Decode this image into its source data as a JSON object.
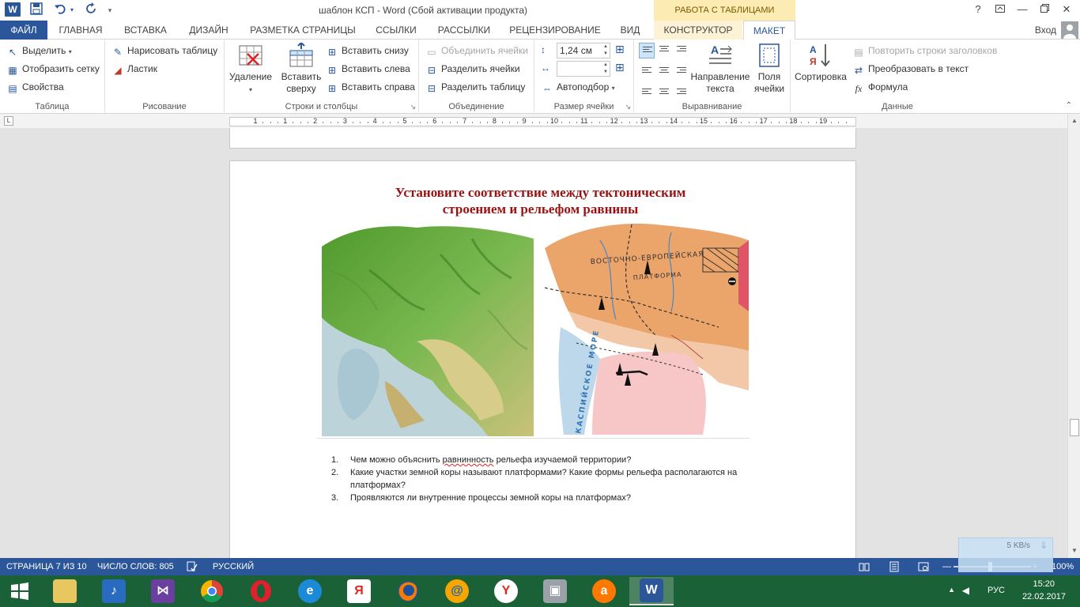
{
  "window": {
    "title": "шаблон КСП - Word (Сбой активации продукта)",
    "table_tools": "РАБОТА С ТАБЛИЦАМИ",
    "login": "Вход",
    "app_badge": "W"
  },
  "tabs": [
    {
      "label": "ФАЙЛ"
    },
    {
      "label": "ГЛАВНАЯ"
    },
    {
      "label": "ВСТАВКА"
    },
    {
      "label": "ДИЗАЙН"
    },
    {
      "label": "РАЗМЕТКА СТРАНИЦЫ"
    },
    {
      "label": "ССЫЛКИ"
    },
    {
      "label": "РАССЫЛКИ"
    },
    {
      "label": "РЕЦЕНЗИРОВАНИЕ"
    },
    {
      "label": "ВИД"
    },
    {
      "label": "КОНСТРУКТОР"
    },
    {
      "label": "МАКЕТ"
    }
  ],
  "ribbon": {
    "table": {
      "label": "Таблица",
      "select": "Выделить",
      "show_grid": "Отобразить сетку",
      "properties": "Свойства"
    },
    "draw": {
      "label": "Рисование",
      "draw_table": "Нарисовать таблицу",
      "eraser": "Ластик"
    },
    "rows_cols": {
      "label": "Строки и столбцы",
      "delete": "Удаление",
      "insert_above_1": "Вставить",
      "insert_above_2": "сверху",
      "insert_below": "Вставить снизу",
      "insert_left": "Вставить слева",
      "insert_right": "Вставить справа"
    },
    "merge": {
      "label": "Объединение",
      "merge_cells": "Объединить ячейки",
      "split_cells": "Разделить ячейки",
      "split_table": "Разделить таблицу"
    },
    "cell_size": {
      "label": "Размер ячейки",
      "height_value": "1,24 см",
      "width_value": "",
      "autofit": "Автоподбор"
    },
    "alignment": {
      "label": "Выравнивание",
      "text_direction_1": "Направление",
      "text_direction_2": "текста",
      "cell_margins_1": "Поля",
      "cell_margins_2": "ячейки"
    },
    "data": {
      "label": "Данные",
      "sort": "Сортировка",
      "repeat_header": "Повторить строки заголовков",
      "convert_text": "Преобразовать в текст",
      "formula": "Формула"
    }
  },
  "ruler": {
    "numbers": [
      "1",
      "1",
      "2",
      "3",
      "4",
      "5",
      "6",
      "7",
      "8",
      "9",
      "10",
      "11",
      "12",
      "13",
      "14",
      "15",
      "16",
      "17",
      "18",
      "19"
    ]
  },
  "document": {
    "slide_title_1": "Установите соответствие между тектоническим",
    "slide_title_2": "строением и рельефом равнины",
    "map_labels": {
      "platform_1": "ВОСТОЧНО-ЕВРОПЕЙСКАЯ",
      "platform_2": "ПЛАТФОРМА",
      "sea": "КАСПИЙСКОЕ МОРЕ"
    },
    "questions": [
      {
        "num": "1.",
        "pre": "Чем можно объяснить ",
        "spell": "равнинность",
        "post": " рельефа изучаемой территории?"
      },
      {
        "num": "2.",
        "text": "Какие участки земной коры называют платформами? Какие формы рельефа располагаются на платформах?"
      },
      {
        "num": "3.",
        "text": "Проявляются ли внутренние процессы земной коры на платформах?"
      }
    ]
  },
  "statusbar": {
    "page": "СТРАНИЦА 7 ИЗ 10",
    "words": "ЧИСЛО СЛОВ: 805",
    "language": "РУССКИЙ",
    "zoom": "100%",
    "net_speed": "5 KB/s"
  },
  "taskbar": {
    "items": [
      {
        "name": "start-button",
        "label": ""
      },
      {
        "name": "explorer",
        "label": ""
      },
      {
        "name": "media",
        "label": ""
      },
      {
        "name": "visual-studio",
        "label": ""
      },
      {
        "name": "chrome",
        "label": ""
      },
      {
        "name": "opera",
        "label": ""
      },
      {
        "name": "ie",
        "label": ""
      },
      {
        "name": "yandex",
        "label": "Я"
      },
      {
        "name": "firefox",
        "label": ""
      },
      {
        "name": "mail",
        "label": "@"
      },
      {
        "name": "yandex-browser",
        "label": "Y"
      },
      {
        "name": "vm",
        "label": ""
      },
      {
        "name": "avast",
        "label": "a"
      },
      {
        "name": "word",
        "label": "W"
      }
    ],
    "tray_lang": "РУС",
    "time": "15:20",
    "date": "22.02.2017"
  },
  "colors": {
    "accent": "#2b579a",
    "title_red": "#9b1111",
    "taskbar": "#1b6137",
    "table_tools": "#fcebb3"
  }
}
